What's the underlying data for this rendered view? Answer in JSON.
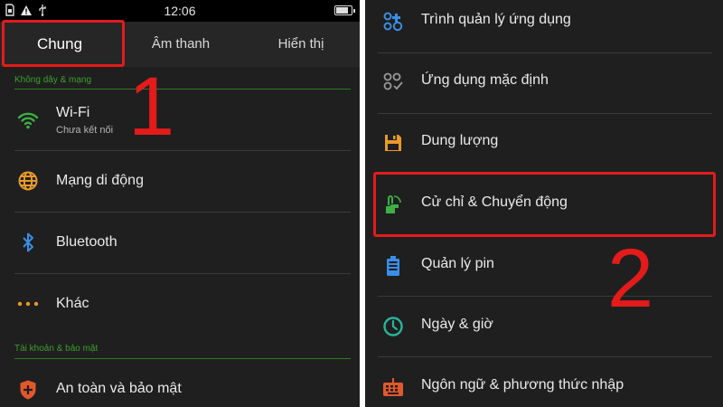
{
  "status_bar": {
    "time": "12:06",
    "icons": [
      "sim-card-icon",
      "warning-icon",
      "usb-icon"
    ],
    "battery_level": 0.85
  },
  "tabs": [
    {
      "label": "Chung",
      "active": true
    },
    {
      "label": "Âm thanh",
      "active": false
    },
    {
      "label": "Hiển thị",
      "active": false
    }
  ],
  "left": {
    "section_wireless": "Không dây & mạng",
    "items": [
      {
        "label": "Wi-Fi",
        "sub": "Chưa kết nối",
        "icon": "wifi-icon",
        "color": "#3cb043"
      },
      {
        "label": "Mạng di động",
        "icon": "globe-icon",
        "color": "#e89a2a"
      },
      {
        "label": "Bluetooth",
        "icon": "bluetooth-icon",
        "color": "#3a8ee6"
      },
      {
        "label": "Khác",
        "icon": "more-dots-icon",
        "color": "#e89a2a"
      }
    ],
    "section_accounts": "Tài khoản & bảo mật",
    "security_item": {
      "label": "An toàn và bảo mật",
      "icon": "shield-icon",
      "color": "#e2582a"
    }
  },
  "right": {
    "items": [
      {
        "label": "Trình quản lý ứng dụng",
        "icon": "app-manager-icon",
        "color": "#3a8ee6"
      },
      {
        "label": "Ứng dụng mặc định",
        "icon": "default-apps-icon",
        "color": "#9a9a9a"
      },
      {
        "label": "Dung lượng",
        "icon": "storage-icon",
        "color": "#e89a2a"
      },
      {
        "label": "Cử chỉ & Chuyển động",
        "icon": "gesture-icon",
        "color": "#3cb043"
      },
      {
        "label": "Quản lý pin",
        "icon": "battery-icon",
        "color": "#3a8ee6"
      },
      {
        "label": "Ngày & giờ",
        "icon": "clock-icon",
        "color": "#2bb39a"
      },
      {
        "label": "Ngôn ngữ & phương thức nhập",
        "icon": "keyboard-icon",
        "color": "#e2582a"
      }
    ]
  },
  "annotations": {
    "step1": "1",
    "step2": "2",
    "color": "#e31b1b"
  }
}
